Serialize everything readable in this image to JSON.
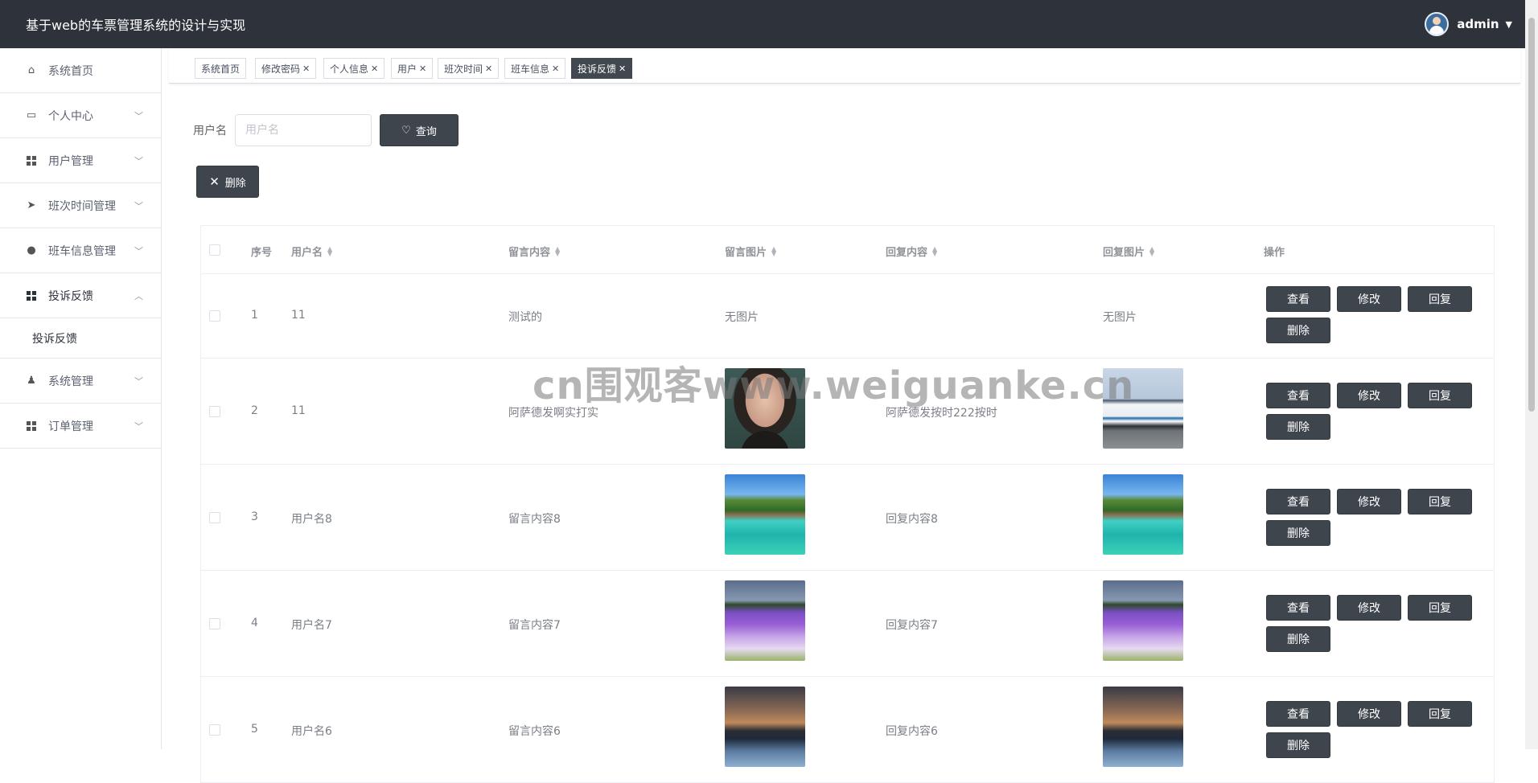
{
  "header": {
    "title": "基于web的车票管理系统的设计与实现",
    "username": "admin"
  },
  "sidebar": {
    "items": [
      {
        "label": "系统首页",
        "icon": "home-icon"
      },
      {
        "label": "个人中心",
        "icon": "wallet-icon"
      },
      {
        "label": "用户管理",
        "icon": "grid-icon"
      },
      {
        "label": "班次时间管理",
        "icon": "send-icon"
      },
      {
        "label": "班车信息管理",
        "icon": "balloon-icon"
      },
      {
        "label": "投诉反馈",
        "icon": "grid-icon"
      },
      {
        "label": "系统管理",
        "icon": "user-icon"
      },
      {
        "label": "订单管理",
        "icon": "grid-icon"
      }
    ],
    "sub_item": "投诉反馈"
  },
  "tabs": [
    {
      "label": "系统首页"
    },
    {
      "label": "修改密码"
    },
    {
      "label": "个人信息"
    },
    {
      "label": "用户"
    },
    {
      "label": "班次时间"
    },
    {
      "label": "班车信息"
    },
    {
      "label": "投诉反馈"
    }
  ],
  "search": {
    "label": "用户名",
    "placeholder": "用户名",
    "value": "",
    "button": "查询"
  },
  "toolbar": {
    "delete_label": "删除"
  },
  "table": {
    "headers": {
      "index": "序号",
      "username": "用户名",
      "content": "留言内容",
      "image": "留言图片",
      "reply": "回复内容",
      "reply_image": "回复图片",
      "actions": "操作"
    },
    "rows": [
      {
        "index": "1",
        "username": "11",
        "content": "测试的",
        "image": "无图片",
        "reply": "",
        "reply_image": "无图片"
      },
      {
        "index": "2",
        "username": "11",
        "content": "阿萨德发啊实打实",
        "image": "portrait",
        "reply": "阿萨德发按时222按时",
        "reply_image": "bus"
      },
      {
        "index": "3",
        "username": "用户名8",
        "content": "留言内容8",
        "image": "sea",
        "reply": "回复内容8",
        "reply_image": "sea"
      },
      {
        "index": "4",
        "username": "用户名7",
        "content": "留言内容7",
        "image": "lav",
        "reply": "回复内容7",
        "reply_image": "lav"
      },
      {
        "index": "5",
        "username": "用户名6",
        "content": "留言内容6",
        "image": "dusk",
        "reply": "回复内容6",
        "reply_image": "dusk"
      }
    ],
    "actions": {
      "view": "查看",
      "edit": "修改",
      "reply": "回复",
      "delete": "删除"
    }
  },
  "watermark": "cn围观客www.weiguanke.cn"
}
